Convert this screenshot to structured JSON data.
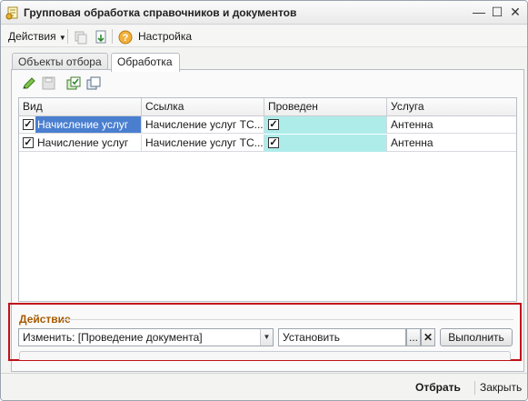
{
  "window": {
    "title": "Групповая обработка справочников и документов"
  },
  "toolbar": {
    "actions_label": "Действия",
    "settings_label": "Настройка"
  },
  "tabs": [
    {
      "label": "Объекты отбора",
      "active": false
    },
    {
      "label": "Обработка",
      "active": true
    }
  ],
  "table": {
    "columns": [
      "Вид",
      "Ссылка",
      "Проведен",
      "Услуга"
    ],
    "rows": [
      {
        "checked": true,
        "vid": "Начисление услуг",
        "ssylka": "Начисление услуг ТС...",
        "proveden": true,
        "usluga": "Антенна"
      },
      {
        "checked": true,
        "vid": "Начисление услуг",
        "ssylka": "Начисление услуг ТС...",
        "proveden": true,
        "usluga": "Антенна"
      }
    ]
  },
  "action": {
    "label": "Действие",
    "mode_value": "Изменить: [Проведение документа]",
    "value_field": "Установить",
    "ellipsis_label": "...",
    "clear_label": "✕",
    "run_label": "Выполнить"
  },
  "footer": {
    "select_label": "Отбрать",
    "close_label": "Закрыть"
  },
  "colors": {
    "selection_blue": "#4a7fd0",
    "selection_cyan": "#aeecea",
    "highlight_frame": "#c0111a",
    "section_label": "#a85a00"
  }
}
